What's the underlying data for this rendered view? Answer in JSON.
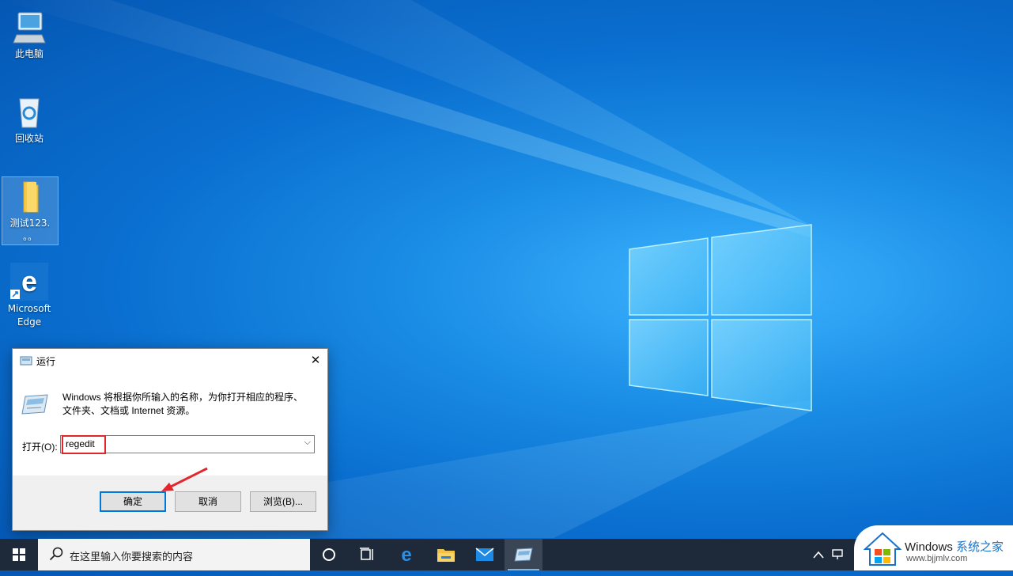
{
  "desktop": {
    "icons": [
      {
        "label": "此电脑"
      },
      {
        "label": "回收站"
      },
      {
        "label": "测试123.",
        "label2": "。。"
      },
      {
        "label": "Microsoft",
        "label2": "Edge"
      }
    ]
  },
  "run_dialog": {
    "title": "运行",
    "close_glyph": "✕",
    "description_line1": "Windows 将根据你所输入的名称，为你打开相应的程序、",
    "description_line2": "文件夹、文档或 Internet 资源。",
    "open_label": "打开(O):",
    "open_value": "regedit",
    "buttons": {
      "ok": "确定",
      "cancel": "取消",
      "browse": "浏览(B)..."
    }
  },
  "taskbar": {
    "search_placeholder": "在这里输入你要搜索的内容",
    "icons": [
      "windows-start-icon",
      "search-icon",
      "cortana-circle-icon",
      "task-view-icon",
      "edge-icon",
      "file-explorer-icon",
      "mail-icon",
      "run-icon"
    ],
    "tray_icons": [
      "chevron-up-icon",
      "network-icon"
    ]
  },
  "watermark": {
    "brand": "Windows",
    "brand_cn": "系统之家",
    "url": "www.bjjmlv.com"
  },
  "colors": {
    "accent": "#0078d7",
    "highlight_red": "#e3262c",
    "taskbar": "#1e2a3a"
  }
}
